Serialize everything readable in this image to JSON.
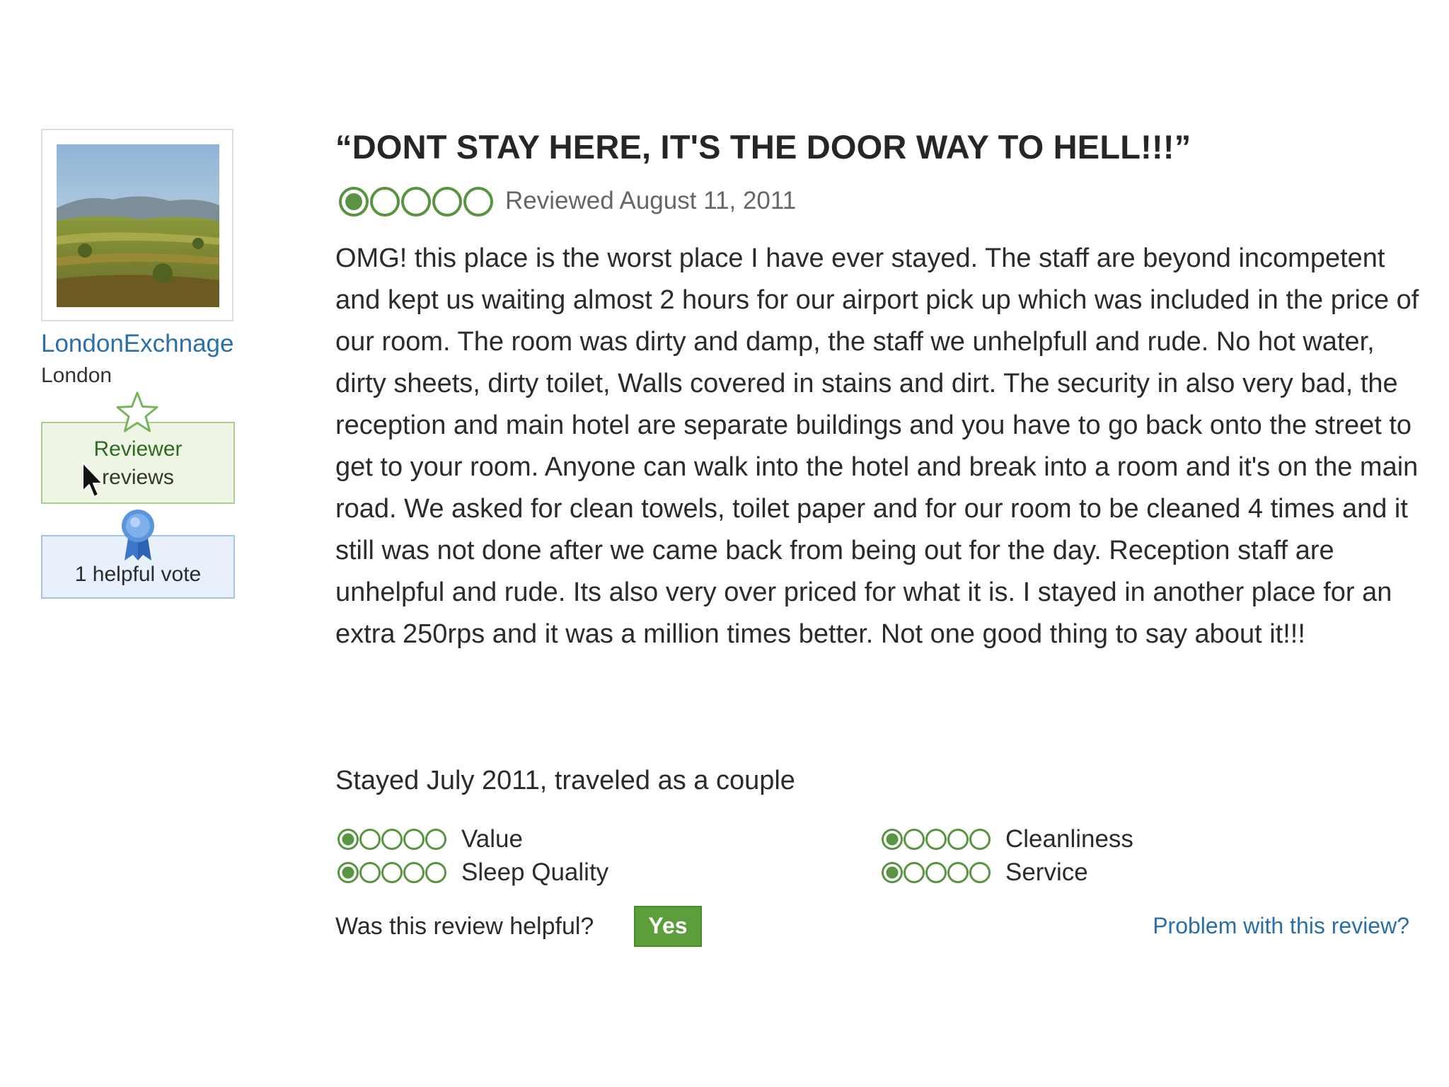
{
  "reviewer": {
    "username": "LondonExchnage",
    "location": "London",
    "badge_title": "Reviewer",
    "badge_sub": "reviews",
    "helpful_votes": "1 helpful vote"
  },
  "review": {
    "title": "“DONT STAY HERE, IT'S THE DOOR WAY TO HELL!!!”",
    "overall_rating": 1,
    "rating_max": 5,
    "date": "Reviewed August 11, 2011",
    "body": "OMG! this place is the worst place I have ever stayed. The staff are beyond incompetent and kept us waiting almost 2 hours for our airport pick up which was included in the price of our room. The room was dirty and damp, the staff we unhelpfull and rude. No hot water, dirty sheets, dirty toilet, Walls covered in stains and dirt. The security in also very bad, the reception and main hotel are separate buildings and you have to go back onto the street to get to your room. Anyone can walk into the hotel and break into a room and it's on the main road. We asked for clean towels, toilet paper and for our room to be cleaned 4 times and it still was not done after we came back from being out for the day. Reception staff are unhelpful and rude. Its also very over priced for what it is. I stayed in another place for an extra 250rps and it was a million times better. Not one good thing to say about it!!!",
    "stay_info": "Stayed July 2011, traveled as a couple",
    "sub_ratings": [
      {
        "label": "Value",
        "rating": 1
      },
      {
        "label": "Cleanliness",
        "rating": 1
      },
      {
        "label": "Sleep Quality",
        "rating": 1
      },
      {
        "label": "Service",
        "rating": 1
      }
    ],
    "helpful_question": "Was this review helpful?",
    "yes_label": "Yes",
    "problem_link": "Problem with this review?"
  },
  "colors": {
    "bubble_green": "#589442",
    "link_blue": "#2a6fa8",
    "yes_green": "#5c9e3a"
  },
  "icons": [
    "star-icon",
    "cursor-icon",
    "ribbon-icon",
    "rating-bubbles"
  ]
}
